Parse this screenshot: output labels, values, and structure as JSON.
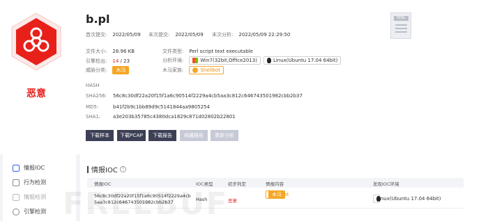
{
  "file": {
    "name": "b.pl",
    "verdict": "恶意"
  },
  "meta": {
    "first_submit": {
      "label": "首次提交:",
      "value": "2022/05/09"
    },
    "last_submit": {
      "label": "末次提交:",
      "value": "2022/05/09"
    },
    "last_analysis": {
      "label": "末次分析:",
      "value": "2022/05/09 22:29:50"
    },
    "file_size": {
      "label": "文件大小:",
      "value": "28.96 KB"
    },
    "file_type": {
      "label": "文件类型:",
      "value": "Perl script text executable"
    },
    "engine_detect": {
      "label": "引擎检出:",
      "value_hit": "14",
      "value_sep": "/",
      "value_total": "23"
    },
    "env": {
      "label": "分析环境:",
      "win": "Win7(32bit,Office2013)",
      "linux": "Linux(Ubuntu 17.04 64bit)"
    },
    "threat_class": {
      "label": "威胁分类:",
      "value": "木马"
    },
    "trojan_family": {
      "label": "木马家族:",
      "value": "Shellbot"
    }
  },
  "hashes": {
    "title": "HASH",
    "sha256": {
      "label": "SHA256:",
      "value": "56c8c30df22a20f15f1a6c90514f2229a4cb5aa3c812c646743501982cbb2b37"
    },
    "md5": {
      "label": "MD5:",
      "value": "b41f2b9c1bb89d9c5141844aa9805254"
    },
    "sha1": {
      "label": "SHA1:",
      "value": "a3e203b35785c4380dca1829c871d02802b22801"
    }
  },
  "buttons": {
    "download_sample": "下载样本",
    "download_pcap": "下载PCAP",
    "download_report": "下载报告",
    "save_report": "收藏报告",
    "reanalyze": "重新分析"
  },
  "file_icon_badge": "PERL",
  "sidebar": {
    "items": [
      {
        "label": "情报IOC"
      },
      {
        "label": "行为检测"
      },
      {
        "label": "情报检测"
      },
      {
        "label": "引擎检测"
      }
    ]
  },
  "ioc": {
    "title": "情报IOC",
    "help": "?",
    "headers": [
      "情报IOC",
      "IOC类型",
      "初步判定",
      "情报内容",
      "发现IOC环境"
    ],
    "row": {
      "ioc_line1": "56c8c30df22a20f15f1a6c90514f2229a4cb",
      "ioc_line2": "5aa3c812c646743501982cbb2b37",
      "type": "Hash",
      "verdict": "恶意",
      "content_family": "Shellbot",
      "content_class": "木马",
      "env": "Linux(Ubuntu 17.04 64bit)"
    }
  },
  "watermark": "FREEBUF",
  "colors": {
    "danger": "#e8201a",
    "accent_orange": "#f5a623",
    "dark_button": "#3c3f55"
  }
}
